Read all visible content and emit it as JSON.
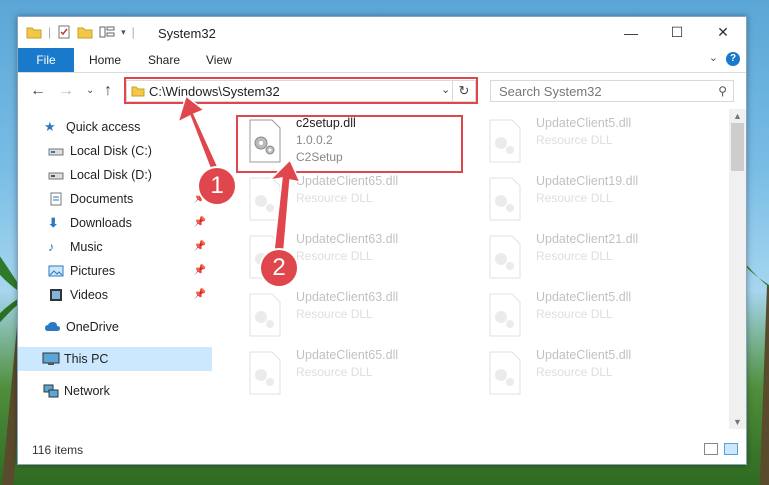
{
  "window": {
    "title": "System32"
  },
  "ribbon": {
    "file": "File",
    "tabs": [
      "Home",
      "Share",
      "View"
    ],
    "help": "?"
  },
  "address": {
    "path": "C:\\Windows\\System32"
  },
  "search": {
    "placeholder": "Search System32"
  },
  "sidebar": {
    "items": [
      {
        "label": "Quick access",
        "icon": "star-icon"
      },
      {
        "label": "Local Disk (C:)",
        "icon": "drive-icon"
      },
      {
        "label": "Local Disk (D:)",
        "icon": "drive-icon"
      },
      {
        "label": "Documents",
        "icon": "documents-icon"
      },
      {
        "label": "Downloads",
        "icon": "download-icon"
      },
      {
        "label": "Music",
        "icon": "music-icon"
      },
      {
        "label": "Pictures",
        "icon": "pictures-icon"
      },
      {
        "label": "Videos",
        "icon": "videos-icon"
      },
      {
        "label": "OneDrive",
        "icon": "cloud-icon"
      },
      {
        "label": "This PC",
        "icon": "computer-icon",
        "selected": true
      },
      {
        "label": "Network",
        "icon": "network-icon"
      }
    ]
  },
  "files": {
    "main": {
      "name": "c2setup.dll",
      "version": "1.0.0.2",
      "desc": "C2Setup"
    },
    "background": [
      {
        "name": "UpdateClient5.dll",
        "desc": "Resource DLL"
      },
      {
        "name": "UpdateClient65.dll",
        "desc": "Resource DLL"
      },
      {
        "name": "UpdateClient19.dll",
        "desc": "Resource DLL"
      },
      {
        "name": "UpdateClient63.dll",
        "desc": "Resource DLL"
      },
      {
        "name": "UpdateClient21.dll",
        "desc": "Resource DLL"
      },
      {
        "name": "UpdateClient63.dll",
        "desc": "Resource DLL"
      },
      {
        "name": "UpdateClient5.dll",
        "desc": "Resource DLL"
      },
      {
        "name": "UpdateClient65.dll",
        "desc": "Resource DLL"
      },
      {
        "name": "UpdateClient5.dll",
        "desc": "Resource DLL"
      }
    ]
  },
  "status": {
    "count": "116 items"
  },
  "annotations": {
    "step1": "1",
    "step2": "2"
  },
  "colors": {
    "accent": "#1979ca",
    "highlight": "#e0474c",
    "selected": "#cce8ff"
  }
}
